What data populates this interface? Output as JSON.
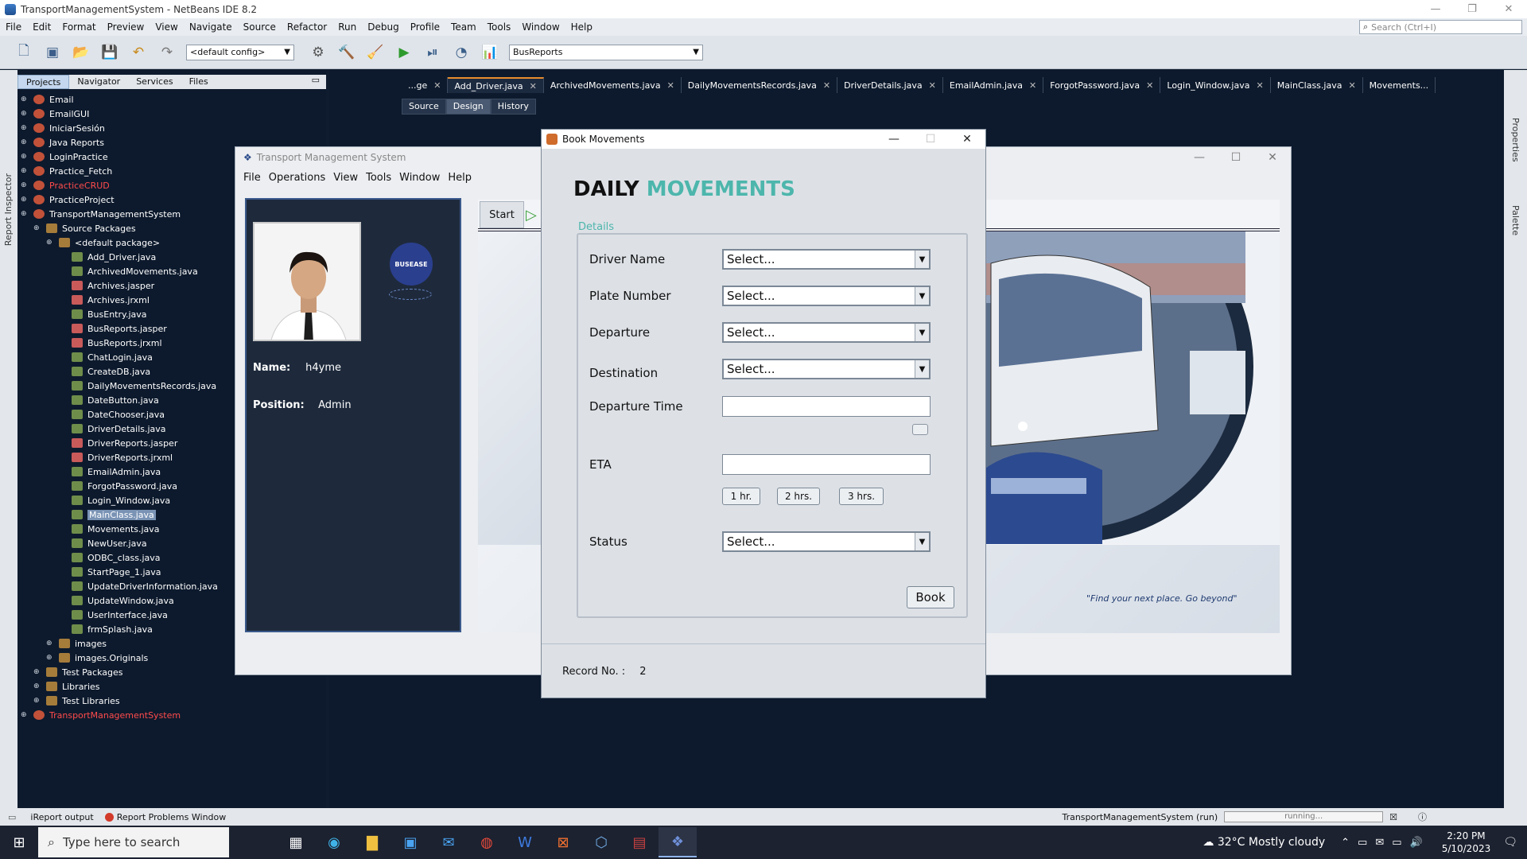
{
  "ide": {
    "title": "TransportManagementSystem - NetBeans IDE 8.2",
    "menu": [
      "File",
      "Edit",
      "Format",
      "Preview",
      "View",
      "Navigate",
      "Source",
      "Refactor",
      "Run",
      "Debug",
      "Profile",
      "Team",
      "Tools",
      "Window",
      "Help"
    ],
    "search_placeholder": "Search (Ctrl+I)",
    "config_combo": "<default config>",
    "reports_combo": "BusReports",
    "left_strip_label": "Report Inspector",
    "panel_tabs": [
      "Projects",
      "Navigator",
      "Services",
      "Files"
    ],
    "tree": [
      {
        "label": "Email",
        "type": "proj",
        "level": 0
      },
      {
        "label": "EmailGUI",
        "type": "proj",
        "level": 0
      },
      {
        "label": "IniciarSesión",
        "type": "proj",
        "level": 0
      },
      {
        "label": "Java Reports",
        "type": "proj",
        "level": 0
      },
      {
        "label": "LoginPractice",
        "type": "proj",
        "level": 0
      },
      {
        "label": "Practice_Fetch",
        "type": "proj",
        "level": 0
      },
      {
        "label": "PracticeCRUD",
        "type": "proj",
        "level": 0,
        "red": true
      },
      {
        "label": "PracticeProject",
        "type": "proj",
        "level": 0
      },
      {
        "label": "TransportManagementSystem",
        "type": "proj",
        "level": 0
      },
      {
        "label": "Source Packages",
        "type": "pkg",
        "level": 1
      },
      {
        "label": "<default package>",
        "type": "pkg",
        "level": 2
      },
      {
        "label": "Add_Driver.java",
        "type": "java",
        "level": 3
      },
      {
        "label": "ArchivedMovements.java",
        "type": "java",
        "level": 3
      },
      {
        "label": "Archives.jasper",
        "type": "jrx",
        "level": 3
      },
      {
        "label": "Archives.jrxml",
        "type": "jrx",
        "level": 3
      },
      {
        "label": "BusEntry.java",
        "type": "java",
        "level": 3
      },
      {
        "label": "BusReports.jasper",
        "type": "jrx",
        "level": 3
      },
      {
        "label": "BusReports.jrxml",
        "type": "jrx",
        "level": 3
      },
      {
        "label": "ChatLogin.java",
        "type": "java",
        "level": 3
      },
      {
        "label": "CreateDB.java",
        "type": "java",
        "level": 3
      },
      {
        "label": "DailyMovementsRecords.java",
        "type": "java",
        "level": 3
      },
      {
        "label": "DateButton.java",
        "type": "java",
        "level": 3
      },
      {
        "label": "DateChooser.java",
        "type": "java",
        "level": 3
      },
      {
        "label": "DriverDetails.java",
        "type": "java",
        "level": 3
      },
      {
        "label": "DriverReports.jasper",
        "type": "jrx",
        "level": 3
      },
      {
        "label": "DriverReports.jrxml",
        "type": "jrx",
        "level": 3
      },
      {
        "label": "EmailAdmin.java",
        "type": "java",
        "level": 3
      },
      {
        "label": "ForgotPassword.java",
        "type": "java",
        "level": 3
      },
      {
        "label": "Login_Window.java",
        "type": "java",
        "level": 3
      },
      {
        "label": "MainClass.java",
        "type": "java",
        "level": 3,
        "selected": true
      },
      {
        "label": "Movements.java",
        "type": "java",
        "level": 3
      },
      {
        "label": "NewUser.java",
        "type": "java",
        "level": 3
      },
      {
        "label": "ODBC_class.java",
        "type": "java",
        "level": 3
      },
      {
        "label": "StartPage_1.java",
        "type": "java",
        "level": 3
      },
      {
        "label": "UpdateDriverInformation.java",
        "type": "java",
        "level": 3
      },
      {
        "label": "UpdateWindow.java",
        "type": "java",
        "level": 3
      },
      {
        "label": "UserInterface.java",
        "type": "java",
        "level": 3
      },
      {
        "label": "frmSplash.java",
        "type": "java",
        "level": 3
      },
      {
        "label": "images",
        "type": "pkg",
        "level": 2
      },
      {
        "label": "images.Originals",
        "type": "pkg",
        "level": 2
      },
      {
        "label": "Test Packages",
        "type": "pkg",
        "level": 1
      },
      {
        "label": "Libraries",
        "type": "pkg",
        "level": 1
      },
      {
        "label": "Test Libraries",
        "type": "pkg",
        "level": 1
      },
      {
        "label": "TransportManagementSystem",
        "type": "proj",
        "level": 0,
        "red": true
      }
    ],
    "editor_tabs": [
      "...ge",
      "Add_Driver.java",
      "ArchivedMovements.java",
      "DailyMovementsRecords.java",
      "DriverDetails.java",
      "EmailAdmin.java",
      "ForgotPassword.java",
      "Login_Window.java",
      "MainClass.java",
      "Movements..."
    ],
    "design_tabs": [
      "Source",
      "Design",
      "History"
    ],
    "right_strip": [
      "Properties",
      "Palette"
    ],
    "status": {
      "ireport": "iReport output",
      "problems": "Report Problems Window",
      "run": "TransportManagementSystem (run)",
      "progress": "running..."
    }
  },
  "tms": {
    "title": "Transport Management System",
    "menu": [
      "File",
      "Operations",
      "View",
      "Tools",
      "Window",
      "Help"
    ],
    "logo_text": "BUSEASE",
    "name_label": "Name:",
    "name_value": "h4yme",
    "position_label": "Position:",
    "position_value": "Admin",
    "start_tab": "Start",
    "tagline": "\"Find your next place. Go beyond\""
  },
  "dialog": {
    "title": "Book Movements",
    "heading_1": "DAILY",
    "heading_2": "MOVEMENTS",
    "legend": "Details",
    "fields": {
      "driver_label": "Driver Name",
      "driver_value": "Select...",
      "plate_label": "Plate Number",
      "plate_value": "Select...",
      "departure_label": "Departure",
      "departure_value": "Select...",
      "destination_label": "Destination",
      "destination_value": "Select...",
      "dep_time_label": "Departure Time",
      "dep_time_value": "",
      "eta_label": "ETA",
      "eta_value": "",
      "status_label": "Status",
      "status_value": "Select..."
    },
    "eta_buttons": [
      "1 hr.",
      "2 hrs.",
      "3 hrs."
    ],
    "book_label": "Book",
    "record_label": "Record No. :",
    "record_value": "2"
  },
  "taskbar": {
    "search_placeholder": "Type here to search",
    "weather": "32°C  Mostly cloudy",
    "time": "2:20 PM",
    "date": "5/10/2023"
  },
  "colors": {
    "accent_teal": "#4db6ac",
    "ide_bg": "#0f1b2e",
    "tab_active": "#e88b2c"
  }
}
